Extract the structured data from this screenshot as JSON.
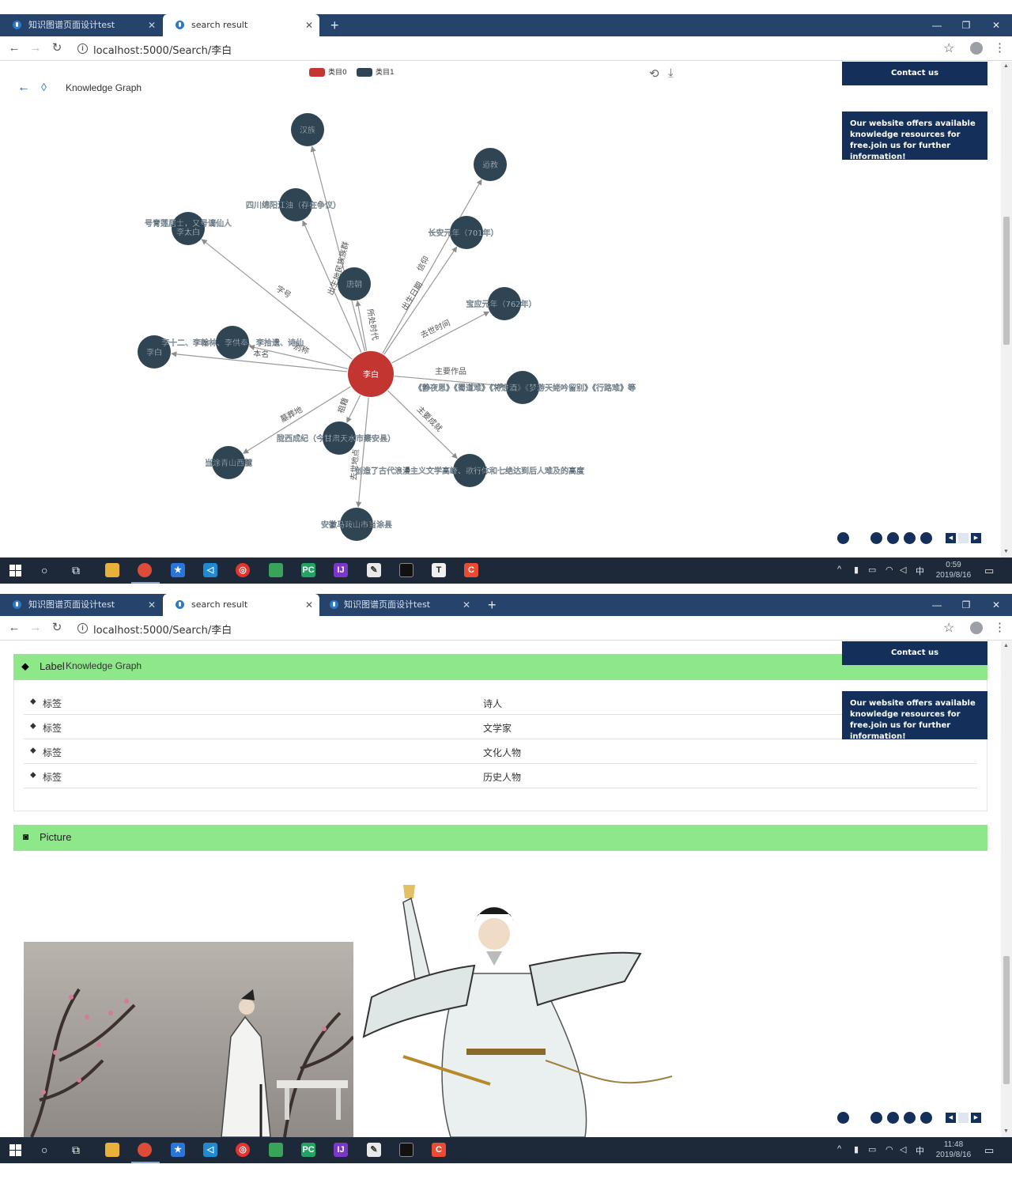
{
  "browser": {
    "tabs_top": [
      {
        "title": "知识图谱页面设计test",
        "active": false
      },
      {
        "title": "search result",
        "active": true
      }
    ],
    "tabs_bottom": [
      {
        "title": "知识图谱页面设计test",
        "active": false
      },
      {
        "title": "search result",
        "active": true
      },
      {
        "title": "知识图谱页面设计test",
        "active": false
      }
    ],
    "new_tab": "+",
    "close_glyph": "✕",
    "url": "localhost:5000/Search/李白",
    "controls": {
      "minimize": "—",
      "maximize": "❐",
      "close": "✕"
    }
  },
  "sidebar": {
    "contact": "Contact us",
    "offer": "Our website offers available knowledge resources for free.join us for further information!"
  },
  "graph": {
    "title": "Knowledge Graph",
    "legend": [
      {
        "name": "类目0",
        "color": "#c23531"
      },
      {
        "name": "类目1",
        "color": "#2f4554"
      }
    ],
    "center": {
      "label": "李白",
      "color": "#c23531"
    },
    "node_color": "#2f4554",
    "nodes": [
      {
        "id": "hanzu",
        "label": "汉族",
        "edge": "民族族群"
      },
      {
        "id": "sichuan",
        "label": "四川绵阳江油（存在争议）",
        "edge": "出生地"
      },
      {
        "id": "taibai",
        "label": "李太白",
        "label2": "号青莲居士，又号谪仙人",
        "edge": "字号"
      },
      {
        "id": "daojiao",
        "label": "道教",
        "edge": "信仰"
      },
      {
        "id": "changan",
        "label": "长安元年（701年）",
        "edge": "出生日期"
      },
      {
        "id": "tang",
        "label": "唐朝",
        "edge": "所处时代"
      },
      {
        "id": "baoying",
        "label": "宝应元年（762年）",
        "edge": "去世时间"
      },
      {
        "id": "libai2",
        "label": "李白",
        "edge": "本名"
      },
      {
        "id": "aliases",
        "label": "李十二、李翰林、李供奉、李拾遗、诗仙",
        "edge": "别称"
      },
      {
        "id": "works",
        "label": "《静夜思》《蜀道难》《将进酒》《梦游天姥吟留别》《行路难》等",
        "edge": "主要作品"
      },
      {
        "id": "qingshan",
        "label": "当涂青山西麓",
        "edge": "墓葬地"
      },
      {
        "id": "longxi",
        "label": "陇西成纪（今甘肃天水市秦安县）",
        "edge": "祖籍"
      },
      {
        "id": "chengjiu",
        "label": "创造了古代浪漫主义文学高峰、歌行体和七绝达到后人难及的高度",
        "edge": "主要成就"
      },
      {
        "id": "anhui",
        "label": "安徽马鞍山市当涂县",
        "edge": "去世地点"
      }
    ]
  },
  "labels_panel": {
    "title": "Label",
    "overlay_text": "Knowledge Graph",
    "rows": [
      {
        "key": "标签",
        "value": "诗人"
      },
      {
        "key": "标签",
        "value": "文学家"
      },
      {
        "key": "标签",
        "value": "文化人物"
      },
      {
        "key": "标签",
        "value": "历史人物"
      }
    ]
  },
  "picture_panel": {
    "title": "Picture"
  },
  "taskbar": {
    "clock_top": {
      "time": "0:59",
      "date": "2019/8/16"
    },
    "clock_bottom": {
      "time": "11:48",
      "date": "2019/8/16"
    },
    "ime": "中",
    "apps": [
      "file-explorer",
      "chrome",
      "app-store",
      "vscode",
      "netease-music",
      "game",
      "pycharm",
      "intellij",
      "notepad",
      "terminal",
      "typora",
      "recorder"
    ]
  },
  "colors": {
    "accent": "#14305a",
    "tabbar": "#26436b",
    "panel_green": "#8ee88a",
    "taskbar": "#1d2838"
  }
}
